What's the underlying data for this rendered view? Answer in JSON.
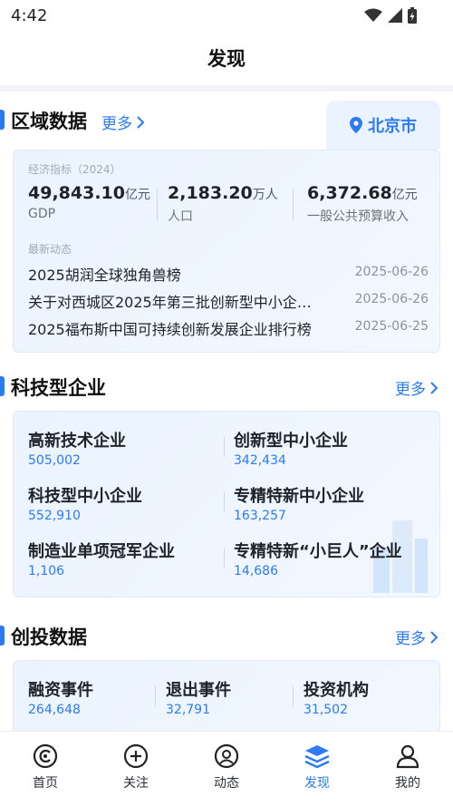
{
  "status": {
    "time": "4:42"
  },
  "header": {
    "title": "发现"
  },
  "region": {
    "title": "区域数据",
    "more": "更多",
    "city": "北京市",
    "eco_label": "经济指标（2024）",
    "stats": [
      {
        "value": "49,843.10",
        "unit": "亿元",
        "label": "GDP"
      },
      {
        "value": "2,183.20",
        "unit": "万人",
        "label": "人口"
      },
      {
        "value": "6,372.68",
        "unit": "亿元",
        "label": "一般公共预算收入"
      }
    ],
    "news_label": "最新动态",
    "news": [
      {
        "title": "2025胡润全球独角兽榜",
        "date": "2025-06-26"
      },
      {
        "title": "关于对西城区2025年第三批创新型中小企…",
        "date": "2025-06-26"
      },
      {
        "title": "2025福布斯中国可持续创新发展企业排行榜",
        "date": "2025-06-25"
      }
    ]
  },
  "tech": {
    "title": "科技型企业",
    "more": "更多",
    "items": [
      {
        "name": "高新技术企业",
        "value": "505,002"
      },
      {
        "name": "创新型中小企业",
        "value": "342,434"
      },
      {
        "name": "科技型中小企业",
        "value": "552,910"
      },
      {
        "name": "专精特新中小企业",
        "value": "163,257"
      },
      {
        "name": "制造业单项冠军企业",
        "value": "1,106"
      },
      {
        "name": "专精特新“小巨人”企业",
        "value": "14,686"
      }
    ]
  },
  "vc": {
    "title": "创投数据",
    "more": "更多",
    "items": [
      {
        "name": "融资事件",
        "value": "264,648"
      },
      {
        "name": "退出事件",
        "value": "32,791"
      },
      {
        "name": "投资机构",
        "value": "31,502"
      }
    ]
  },
  "tabs": [
    {
      "label": "首页",
      "icon": "home-icon"
    },
    {
      "label": "关注",
      "icon": "follow-icon"
    },
    {
      "label": "动态",
      "icon": "news-icon"
    },
    {
      "label": "发现",
      "icon": "discover-icon"
    },
    {
      "label": "我的",
      "icon": "profile-icon"
    }
  ],
  "colors": {
    "accent": "#2b7bf3",
    "card_bg": "#eaf3ff",
    "page_bg": "#f1f4f8"
  }
}
